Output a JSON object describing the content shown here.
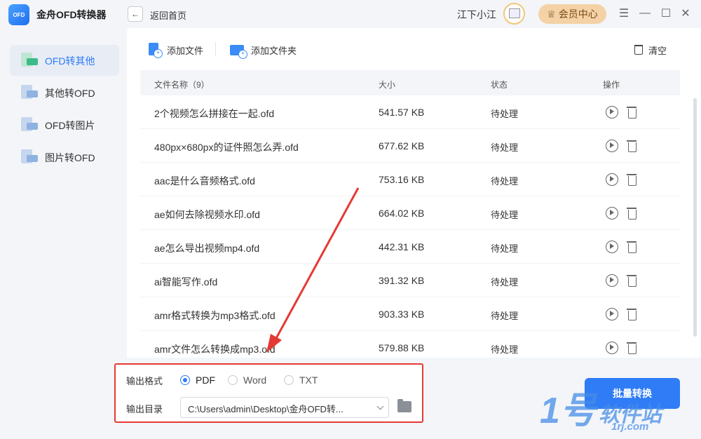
{
  "app": {
    "logo_text": "OFD",
    "title": "金舟OFD转换器"
  },
  "header": {
    "back_label": "返回首页",
    "user_name": "江下小江",
    "vip_label": "会员中心",
    "vip_icon": "crown-icon",
    "controls": [
      "menu-icon",
      "minimize-icon",
      "maximize-icon",
      "close-icon"
    ]
  },
  "sidebar": {
    "items": [
      {
        "label": "OFD转其他",
        "active": true
      },
      {
        "label": "其他转OFD",
        "active": false
      },
      {
        "label": "OFD转图片",
        "active": false
      },
      {
        "label": "图片转OFD",
        "active": false
      }
    ]
  },
  "toolbar": {
    "add_file": "添加文件",
    "add_folder": "添加文件夹",
    "clear": "清空"
  },
  "table": {
    "headers": {
      "name": "文件名称（9）",
      "size": "大小",
      "status": "状态",
      "action": "操作"
    },
    "rows": [
      {
        "name": "2个视频怎么拼接在一起.ofd",
        "size": "541.57 KB",
        "status": "待处理"
      },
      {
        "name": "480px×680px的证件照怎么弄.ofd",
        "size": "677.62 KB",
        "status": "待处理"
      },
      {
        "name": "aac是什么音频格式.ofd",
        "size": "753.16 KB",
        "status": "待处理"
      },
      {
        "name": "ae如何去除视频水印.ofd",
        "size": "664.02 KB",
        "status": "待处理"
      },
      {
        "name": "ae怎么导出视频mp4.ofd",
        "size": "442.31 KB",
        "status": "待处理"
      },
      {
        "name": "ai智能写作.ofd",
        "size": "391.32 KB",
        "status": "待处理"
      },
      {
        "name": "amr格式转换为mp3格式.ofd",
        "size": "903.33 KB",
        "status": "待处理"
      },
      {
        "name": "amr文件怎么转换成mp3.ofd",
        "size": "579.88 KB",
        "status": "待处理"
      }
    ]
  },
  "output": {
    "format_label": "输出格式",
    "formats": [
      {
        "label": "PDF",
        "checked": true
      },
      {
        "label": "Word",
        "checked": false
      },
      {
        "label": "TXT",
        "checked": false
      }
    ],
    "dir_label": "输出目录",
    "dir_value": "C:\\Users\\admin\\Desktop\\金舟OFD转..."
  },
  "convert_label": "批量转换",
  "watermark": {
    "num": "1号",
    "text": "软件站",
    "sub": "1rj.com"
  },
  "colors": {
    "accent": "#2f7cf6",
    "annotation": "#e53935",
    "vip_bg": "#f4d2a6"
  }
}
